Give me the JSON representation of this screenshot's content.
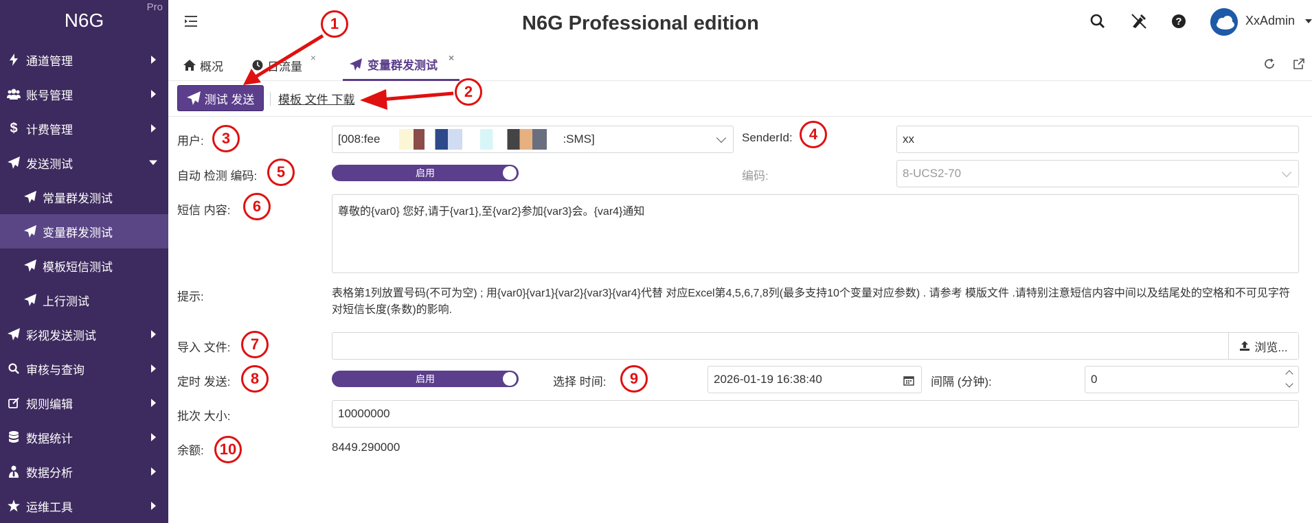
{
  "brand": {
    "name": "N6G",
    "edition_badge": "Pro"
  },
  "header": {
    "title": "N6G Professional edition",
    "username": "XxAdmin"
  },
  "sidebar": {
    "items": [
      {
        "label": "通道管理",
        "icon": "bolt-icon"
      },
      {
        "label": "账号管理",
        "icon": "users-icon"
      },
      {
        "label": "计费管理",
        "icon": "dollar-icon"
      },
      {
        "label": "发送测试",
        "icon": "paper-plane-icon",
        "expanded": true
      },
      {
        "label": "常量群发测试",
        "icon": "paper-plane-icon",
        "sub": true
      },
      {
        "label": "变量群发测试",
        "icon": "paper-plane-icon",
        "sub": true,
        "active": true
      },
      {
        "label": "模板短信测试",
        "icon": "paper-plane-icon",
        "sub": true
      },
      {
        "label": "上行测试",
        "icon": "paper-plane-icon",
        "sub": true
      },
      {
        "label": "彩视发送测试",
        "icon": "paper-plane-icon"
      },
      {
        "label": "审核与查询",
        "icon": "search-icon"
      },
      {
        "label": "规则编辑",
        "icon": "edit-icon"
      },
      {
        "label": "数据统计",
        "icon": "database-icon"
      },
      {
        "label": "数据分析",
        "icon": "user-tie-icon"
      },
      {
        "label": "运维工具",
        "icon": "star-icon"
      }
    ]
  },
  "tabs": [
    {
      "label": "概况",
      "icon": "home-icon"
    },
    {
      "label": "日流量",
      "icon": "clock-icon",
      "close": "×"
    },
    {
      "label": "变量群发测试",
      "icon": "paper-plane-icon",
      "active": true,
      "close": "×"
    }
  ],
  "toolbar": {
    "send_label": "测试 发送",
    "download_label": "模板 文件 下载"
  },
  "form": {
    "user_label": "用户:",
    "user_value_prefix": "[008:fee",
    "user_value_suffix": ":SMS]",
    "sender_label": "SenderId:",
    "sender_value": "xx",
    "auto_detect_label": "自动 检测 编码:",
    "auto_detect_toggle": "启用",
    "encoding_label": "编码:",
    "encoding_value": "8-UCS2-70",
    "content_label": "短信 内容:",
    "content_value": "尊敬的{var0} 您好,请于{var1},至{var2}参加{var3}会。{var4}通知",
    "hint_label": "提示:",
    "hint_text": "表格第1列放置号码(不可为空) ; 用{var0}{var1}{var2}{var3}{var4}代替 对应Excel第4,5,6,7,8列(最多支持10个变量对应参数) . 请参考 模版文件 .请特别注意短信内容中间以及结尾处的空格和不可见字符对短信长度(条数)的影响.",
    "import_label": "导入 文件:",
    "browse_label": "浏览...",
    "schedule_label": "定时 发送:",
    "schedule_toggle": "启用",
    "time_label": "选择 时间:",
    "time_value": "2026-01-19 16:38:40",
    "interval_label": "间隔 (分钟):",
    "interval_value": "0",
    "batch_label": "批次 大小:",
    "batch_value": "10000000",
    "balance_label": "余额:",
    "balance_value": "8449.290000"
  },
  "markers": [
    "1",
    "2",
    "3",
    "4",
    "5",
    "6",
    "7",
    "8",
    "9",
    "10"
  ],
  "colors": {
    "sidebar_bg": "#3d2a5e",
    "accent": "#5b3e8c",
    "marker": "#e01010"
  }
}
